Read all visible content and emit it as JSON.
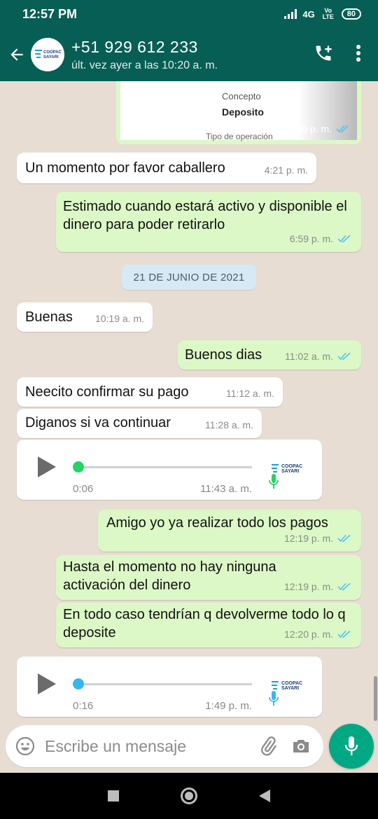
{
  "status_bar": {
    "time": "12:57 PM",
    "network": "4G",
    "volte": "Vo LTE",
    "battery": "80"
  },
  "header": {
    "contact": "+51 929 612 233",
    "last_seen": "últ. vez ayer a las 10:20 a. m.",
    "icons": [
      "back-arrow-icon",
      "add-call-icon",
      "more-vert-icon"
    ]
  },
  "logo_text": [
    "COOPAC",
    "SAYARI"
  ],
  "receipt": {
    "label": "Concepto",
    "value": "Deposito",
    "operation_label": "Tipo de operación",
    "time": "4:20 p. m."
  },
  "date_separator": "21 DE JUNIO DE 2021",
  "messages": [
    {
      "dir": "in",
      "text": "Un momento por favor caballero",
      "time": "4:21 p. m."
    },
    {
      "dir": "out",
      "text": "Estimado cuando estará activo y disponible el dinero para poder retirarlo",
      "time": "6:59 p. m."
    },
    {
      "dir": "in",
      "text": "Buenas",
      "time": "10:19 a. m."
    },
    {
      "dir": "out",
      "text": "Buenos dias",
      "time": "11:02 a. m."
    },
    {
      "dir": "in",
      "text": "Neecito confirmar su pago",
      "time": "11:12 a. m."
    },
    {
      "dir": "in",
      "text": "Diganos si va continuar",
      "time": "11:28 a. m."
    },
    {
      "dir": "out",
      "text": "Amigo yo ya realizar todo los pagos",
      "time": "12:19 p. m."
    },
    {
      "dir": "out",
      "text": "Hasta el momento no hay ninguna activación del dinero",
      "time": "12:19 p. m."
    },
    {
      "dir": "out",
      "text": "En todo caso tendrían q devolverme todo lo q deposite",
      "time": "12:20 p. m."
    }
  ],
  "audio_messages": [
    {
      "duration": "0:06",
      "time": "11:43 a. m.",
      "color": "#25d366"
    },
    {
      "duration": "0:16",
      "time": "1:49 p. m.",
      "color": "#34b7f1"
    }
  ],
  "input": {
    "placeholder": "Escribe un mensaje"
  },
  "colors": {
    "header": "#075e54",
    "outgoing": "#dcf8c6",
    "incoming": "#ffffff",
    "read_ticks": "#4fc3f7",
    "mic_button": "#00a884"
  }
}
